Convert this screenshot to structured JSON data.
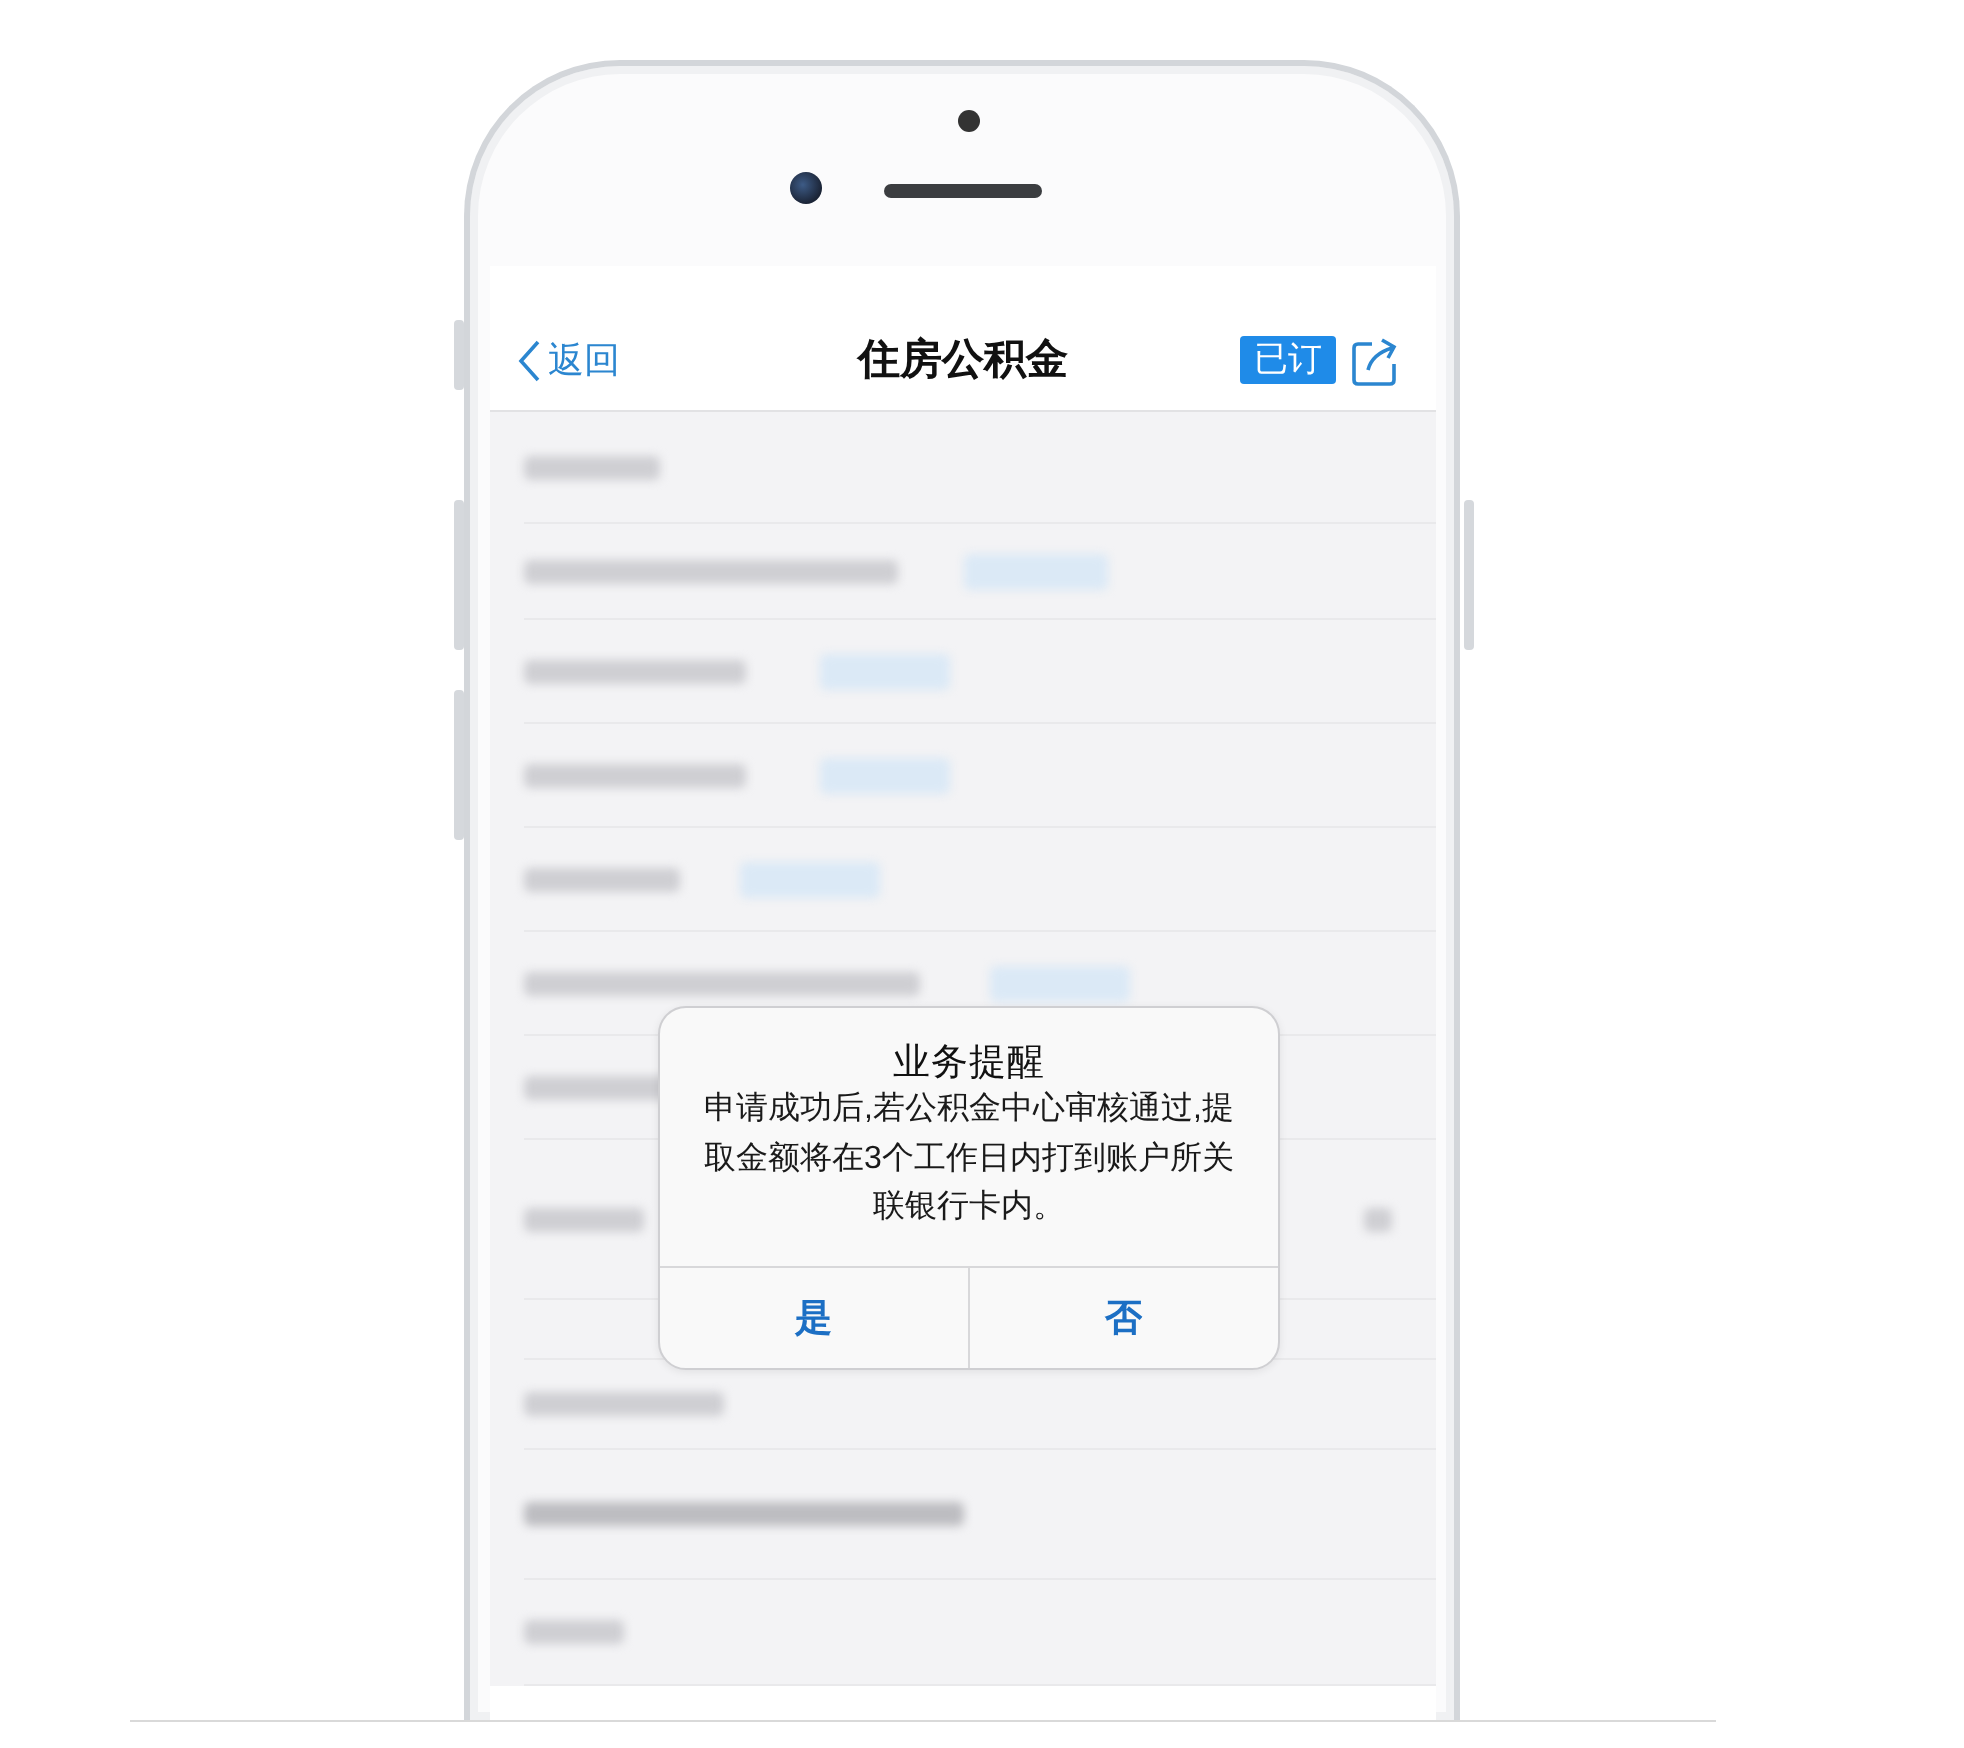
{
  "nav_bar": {
    "back": "返回",
    "title": "住房公积金",
    "subscribe_button": "已订"
  },
  "dialog": {
    "title": "业务提醒",
    "message": "申请成功后,若公积金中心审核通过,提取金额将在3个工作日内打到账户所关联银行卡内。",
    "buttons": [
      "是",
      "否"
    ]
  }
}
